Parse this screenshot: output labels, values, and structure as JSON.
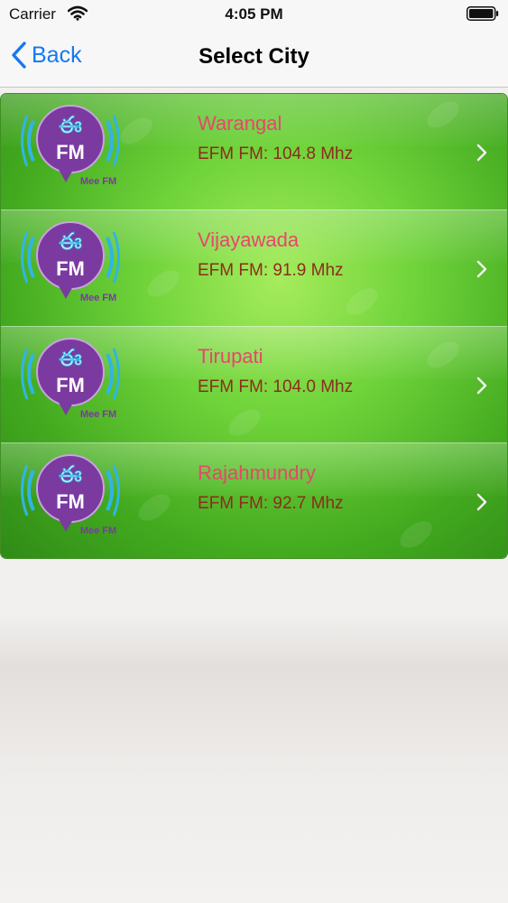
{
  "status_bar": {
    "carrier": "Carrier",
    "time": "4:05 PM"
  },
  "nav": {
    "back_label": "Back",
    "title": "Select City"
  },
  "logo": {
    "badge_text": "FM",
    "caption": "Mee FM",
    "glyph": "ఈ",
    "badge_color": "#7b3aa0"
  },
  "stations": [
    {
      "city": "Warangal",
      "frequency": "EFM FM: 104.8 Mhz"
    },
    {
      "city": "Vijayawada",
      "frequency": "EFM FM: 91.9 Mhz"
    },
    {
      "city": "Tirupati",
      "frequency": "EFM FM: 104.0 Mhz"
    },
    {
      "city": "Rajahmundry",
      "frequency": "EFM FM: 92.7 Mhz"
    }
  ],
  "colors": {
    "accent": "#1478f6",
    "city_text": "#e8466b",
    "frequency_text": "#8a2d1d",
    "list_green": "#5cc22e"
  }
}
